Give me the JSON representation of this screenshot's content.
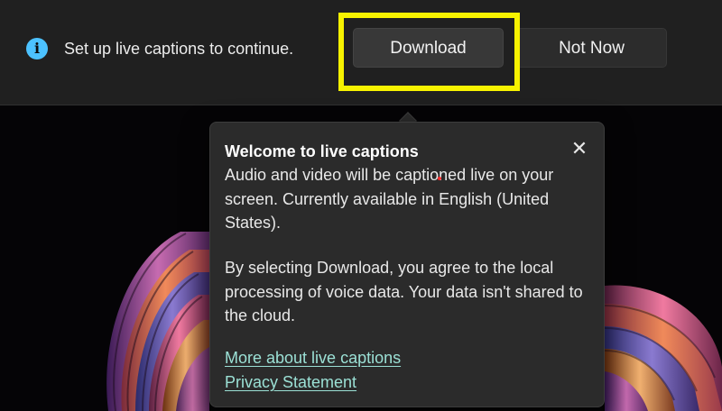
{
  "notification_bar": {
    "icon": "info-icon",
    "icon_glyph": "i",
    "message": "Set up live captions to continue.",
    "download_label": "Download",
    "not_now_label": "Not Now",
    "accent_color": "#4cc2ff",
    "highlight_color": "#f7f200"
  },
  "flyout": {
    "title": "Welcome to live captions",
    "close_glyph": "✕",
    "paragraph_1": "Audio and video will be captioned live on your screen. Currently available in English (United States).",
    "paragraph_2": "By selecting Download, you agree to the local processing of voice data. Your data isn't shared to the cloud.",
    "link_more": "More about live captions",
    "link_privacy": "Privacy Statement",
    "link_color": "#9be0d5"
  }
}
